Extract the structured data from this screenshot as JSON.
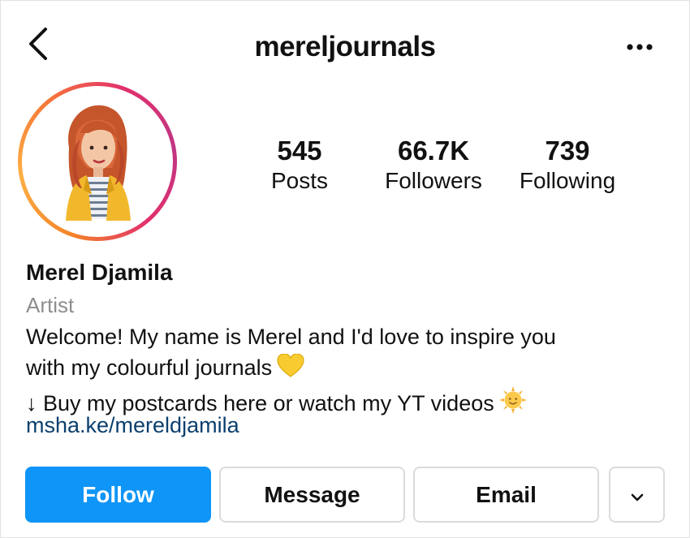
{
  "header": {
    "username": "mereljournals"
  },
  "stats": [
    {
      "value": "545",
      "label": "Posts"
    },
    {
      "value": "66.7K",
      "label": "Followers"
    },
    {
      "value": "739",
      "label": "Following"
    }
  ],
  "profile": {
    "name": "Merel Djamila",
    "category": "Artist",
    "bio_lines": [
      "Welcome! My name is Merel and I'd love to inspire you",
      "with my colourful journals",
      "↓ Buy my postcards here or watch my YT videos"
    ],
    "link": "msha.ke/mereldjamila"
  },
  "buttons": {
    "follow": "Follow",
    "message": "Message",
    "email": "Email"
  },
  "icons": {
    "back": "back-arrow-icon",
    "more": "more-options-icon",
    "heart": "yellow-heart-emoji",
    "sun": "sun-face-emoji",
    "dropdown": "chevron-down-icon"
  },
  "colors": {
    "follow_button": "#0f95f7",
    "link": "#0b3f6e",
    "category": "#8e8e8e",
    "story_ring_start": "#f58529",
    "story_ring_end": "#c13584"
  }
}
